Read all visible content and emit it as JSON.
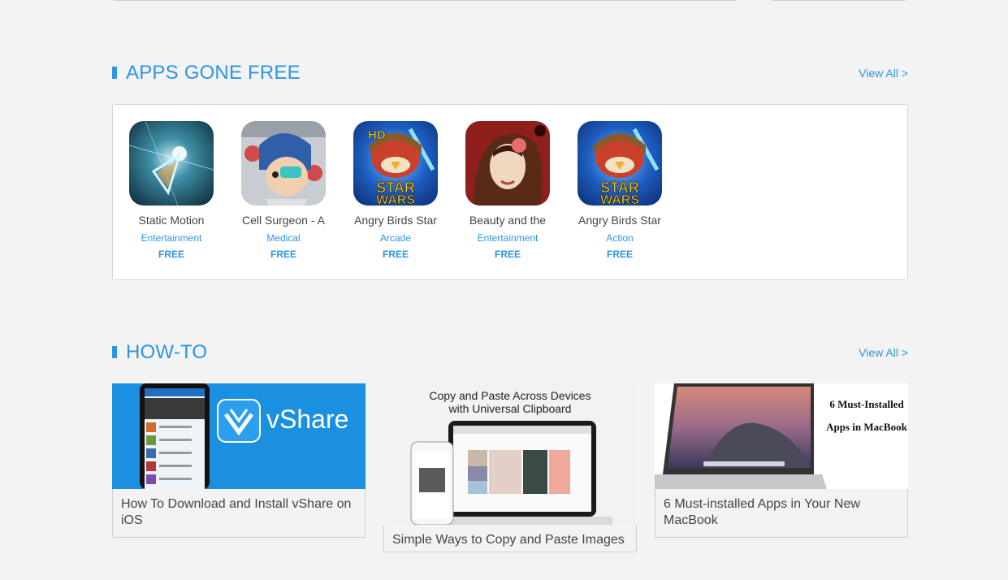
{
  "apps_section": {
    "title": "APPS GONE FREE",
    "view_all": "View All >",
    "apps": [
      {
        "name": "Static Motion",
        "category": "Entertainment",
        "price": "FREE"
      },
      {
        "name": "Cell Surgeon - A",
        "category": "Medical",
        "price": "FREE"
      },
      {
        "name": "Angry Birds Star",
        "category": "Arcade",
        "price": "FREE"
      },
      {
        "name": "Beauty and the",
        "category": "Entertainment",
        "price": "FREE"
      },
      {
        "name": "Angry Birds Star",
        "category": "Action",
        "price": "FREE"
      }
    ]
  },
  "howto_section": {
    "title": "HOW-TO",
    "view_all": "View All >",
    "articles": [
      {
        "title": "How To Download and Install vShare on iOS",
        "thumb_text": "vShare"
      },
      {
        "title": "Simple Ways to Copy and Paste Images",
        "thumb_text": "Copy and Paste Across Devices with Universal Clipboard"
      },
      {
        "title": "6 Must-installed Apps in Your New MacBook",
        "thumb_text": "6 Must-Installed Apps in MacBook"
      }
    ]
  },
  "colors": {
    "accent": "#2d94e6",
    "background": "#f3f3f3"
  }
}
